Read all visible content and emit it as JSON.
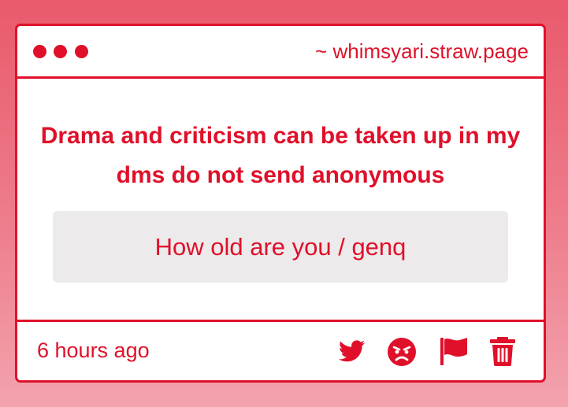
{
  "header": {
    "window_dots": [
      "dot",
      "dot",
      "dot"
    ],
    "site": "~ whimsyari.straw.page"
  },
  "message": {
    "headline": "Drama and criticism can be taken up in my dms do not send anonymous",
    "question": "How old are you / genq"
  },
  "footer": {
    "timestamp": "6 hours ago",
    "actions": [
      {
        "icon": "twitter-icon"
      },
      {
        "icon": "angry-face-icon"
      },
      {
        "icon": "flag-icon"
      },
      {
        "icon": "trash-icon"
      }
    ]
  },
  "colors": {
    "accent": "#e0102a",
    "card_bg": "#ffffff",
    "question_bg": "#eceaeb",
    "page_gradient_top": "#e95a6b",
    "page_gradient_bottom": "#f3a3ae"
  }
}
